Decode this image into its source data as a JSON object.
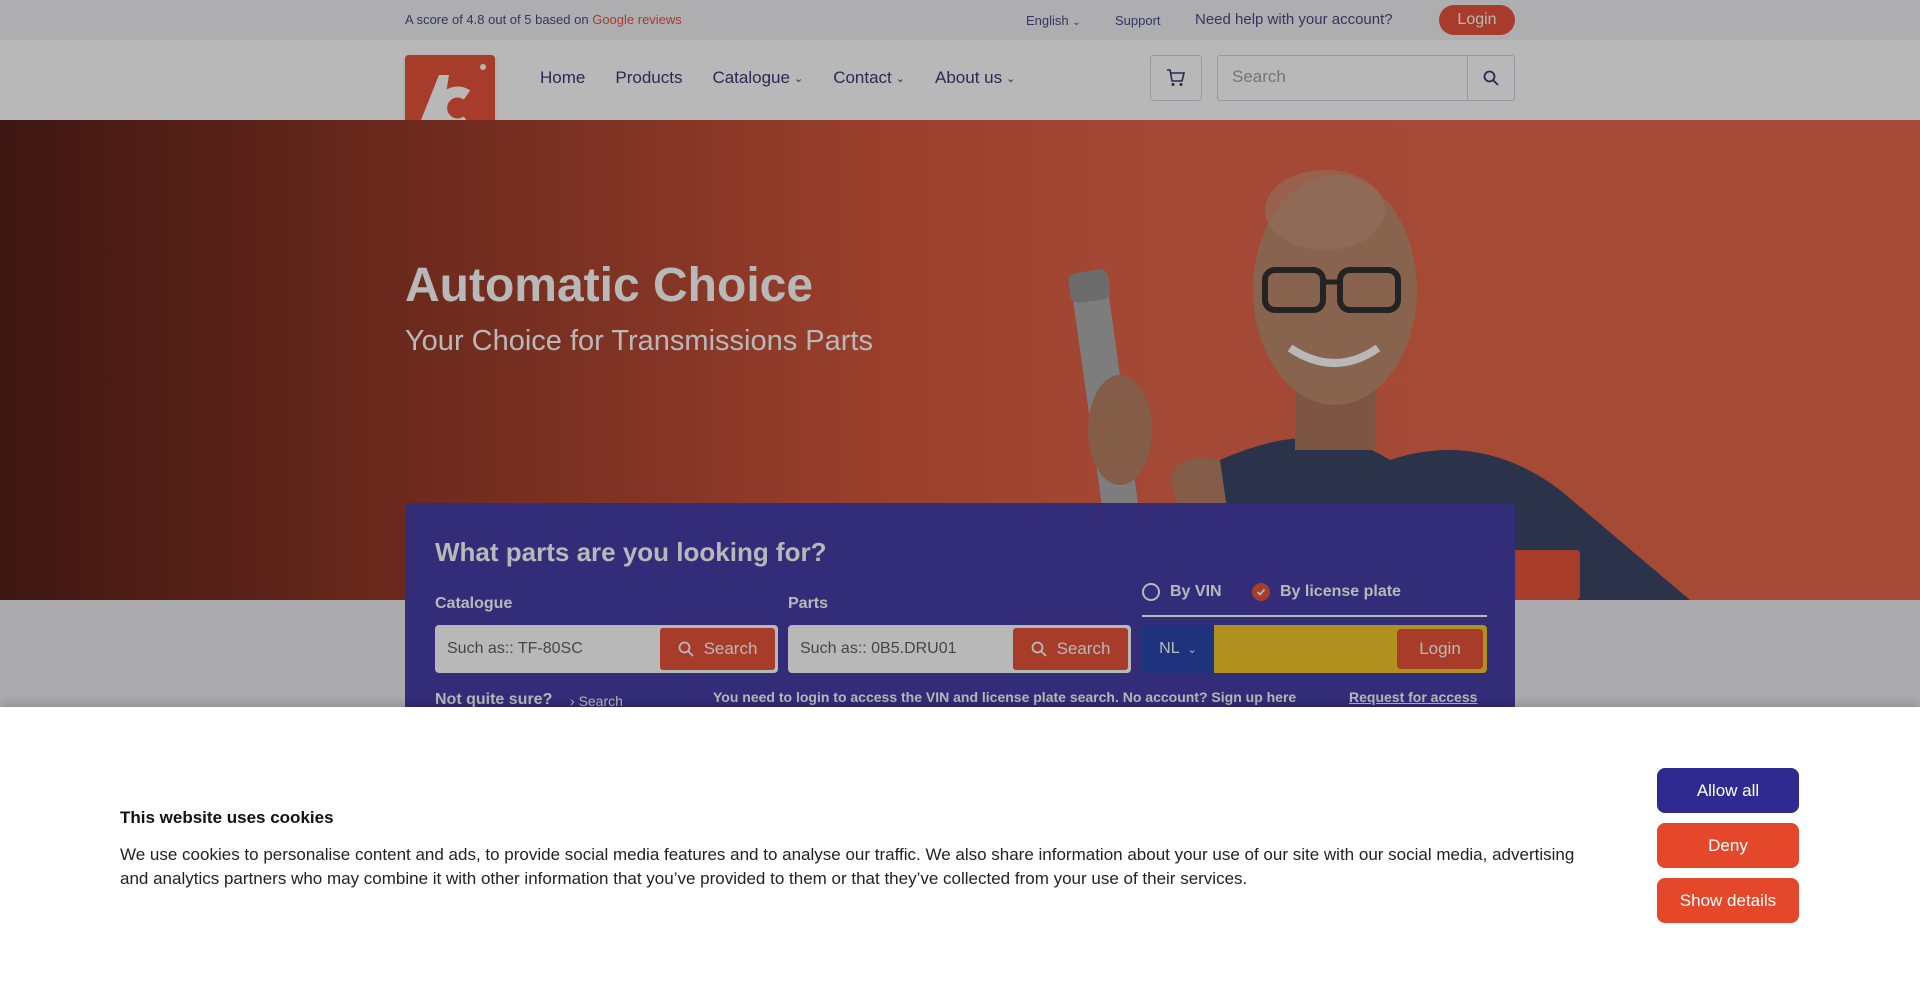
{
  "topbar": {
    "rating_text": "A score of 4.8 out of 5 based on",
    "rating_link": "Google reviews",
    "language": "English",
    "support": "Support",
    "help": "Need help with your account?",
    "login": "Login"
  },
  "nav": {
    "items": [
      {
        "label": "Home",
        "dropdown": false
      },
      {
        "label": "Products",
        "dropdown": false
      },
      {
        "label": "Catalogue",
        "dropdown": true
      },
      {
        "label": "Contact",
        "dropdown": true
      },
      {
        "label": "About us",
        "dropdown": true
      }
    ],
    "search_placeholder": "Search"
  },
  "hero": {
    "title": "Automatic Choice",
    "subtitle": "Your Choice for Transmissions Parts"
  },
  "finder": {
    "title": "What parts are you looking for?",
    "catalogue_label": "Catalogue",
    "catalogue_placeholder": "Such as:: TF-80SC",
    "parts_label": "Parts",
    "parts_placeholder": "Such as:: 0B5.DRU01",
    "search_button": "Search",
    "radio_vin": "By VIN",
    "radio_plate": "By license plate",
    "selected": "By license plate",
    "country": "NL",
    "plate_login": "Login",
    "not_sure": "Not quite sure?",
    "not_sure_link": "Search",
    "login_note": "You need to login to access the VIN and license plate search. No account? Sign up here",
    "request_access": "Request for access"
  },
  "cookie": {
    "title": "This website uses cookies",
    "text": "We use cookies to personalise content and ads, to provide social media features and to analyse our traffic. We also share information about your use of our site with our social media, advertising and analytics partners who may combine it with other information that you’ve provided to them or that they’ve collected from your use of their services.",
    "allow": "Allow all",
    "deny": "Deny",
    "details": "Show details"
  },
  "colors": {
    "accent": "#e4472a",
    "panel": "#3a2fa0",
    "allow_button": "#2f2a8f"
  }
}
